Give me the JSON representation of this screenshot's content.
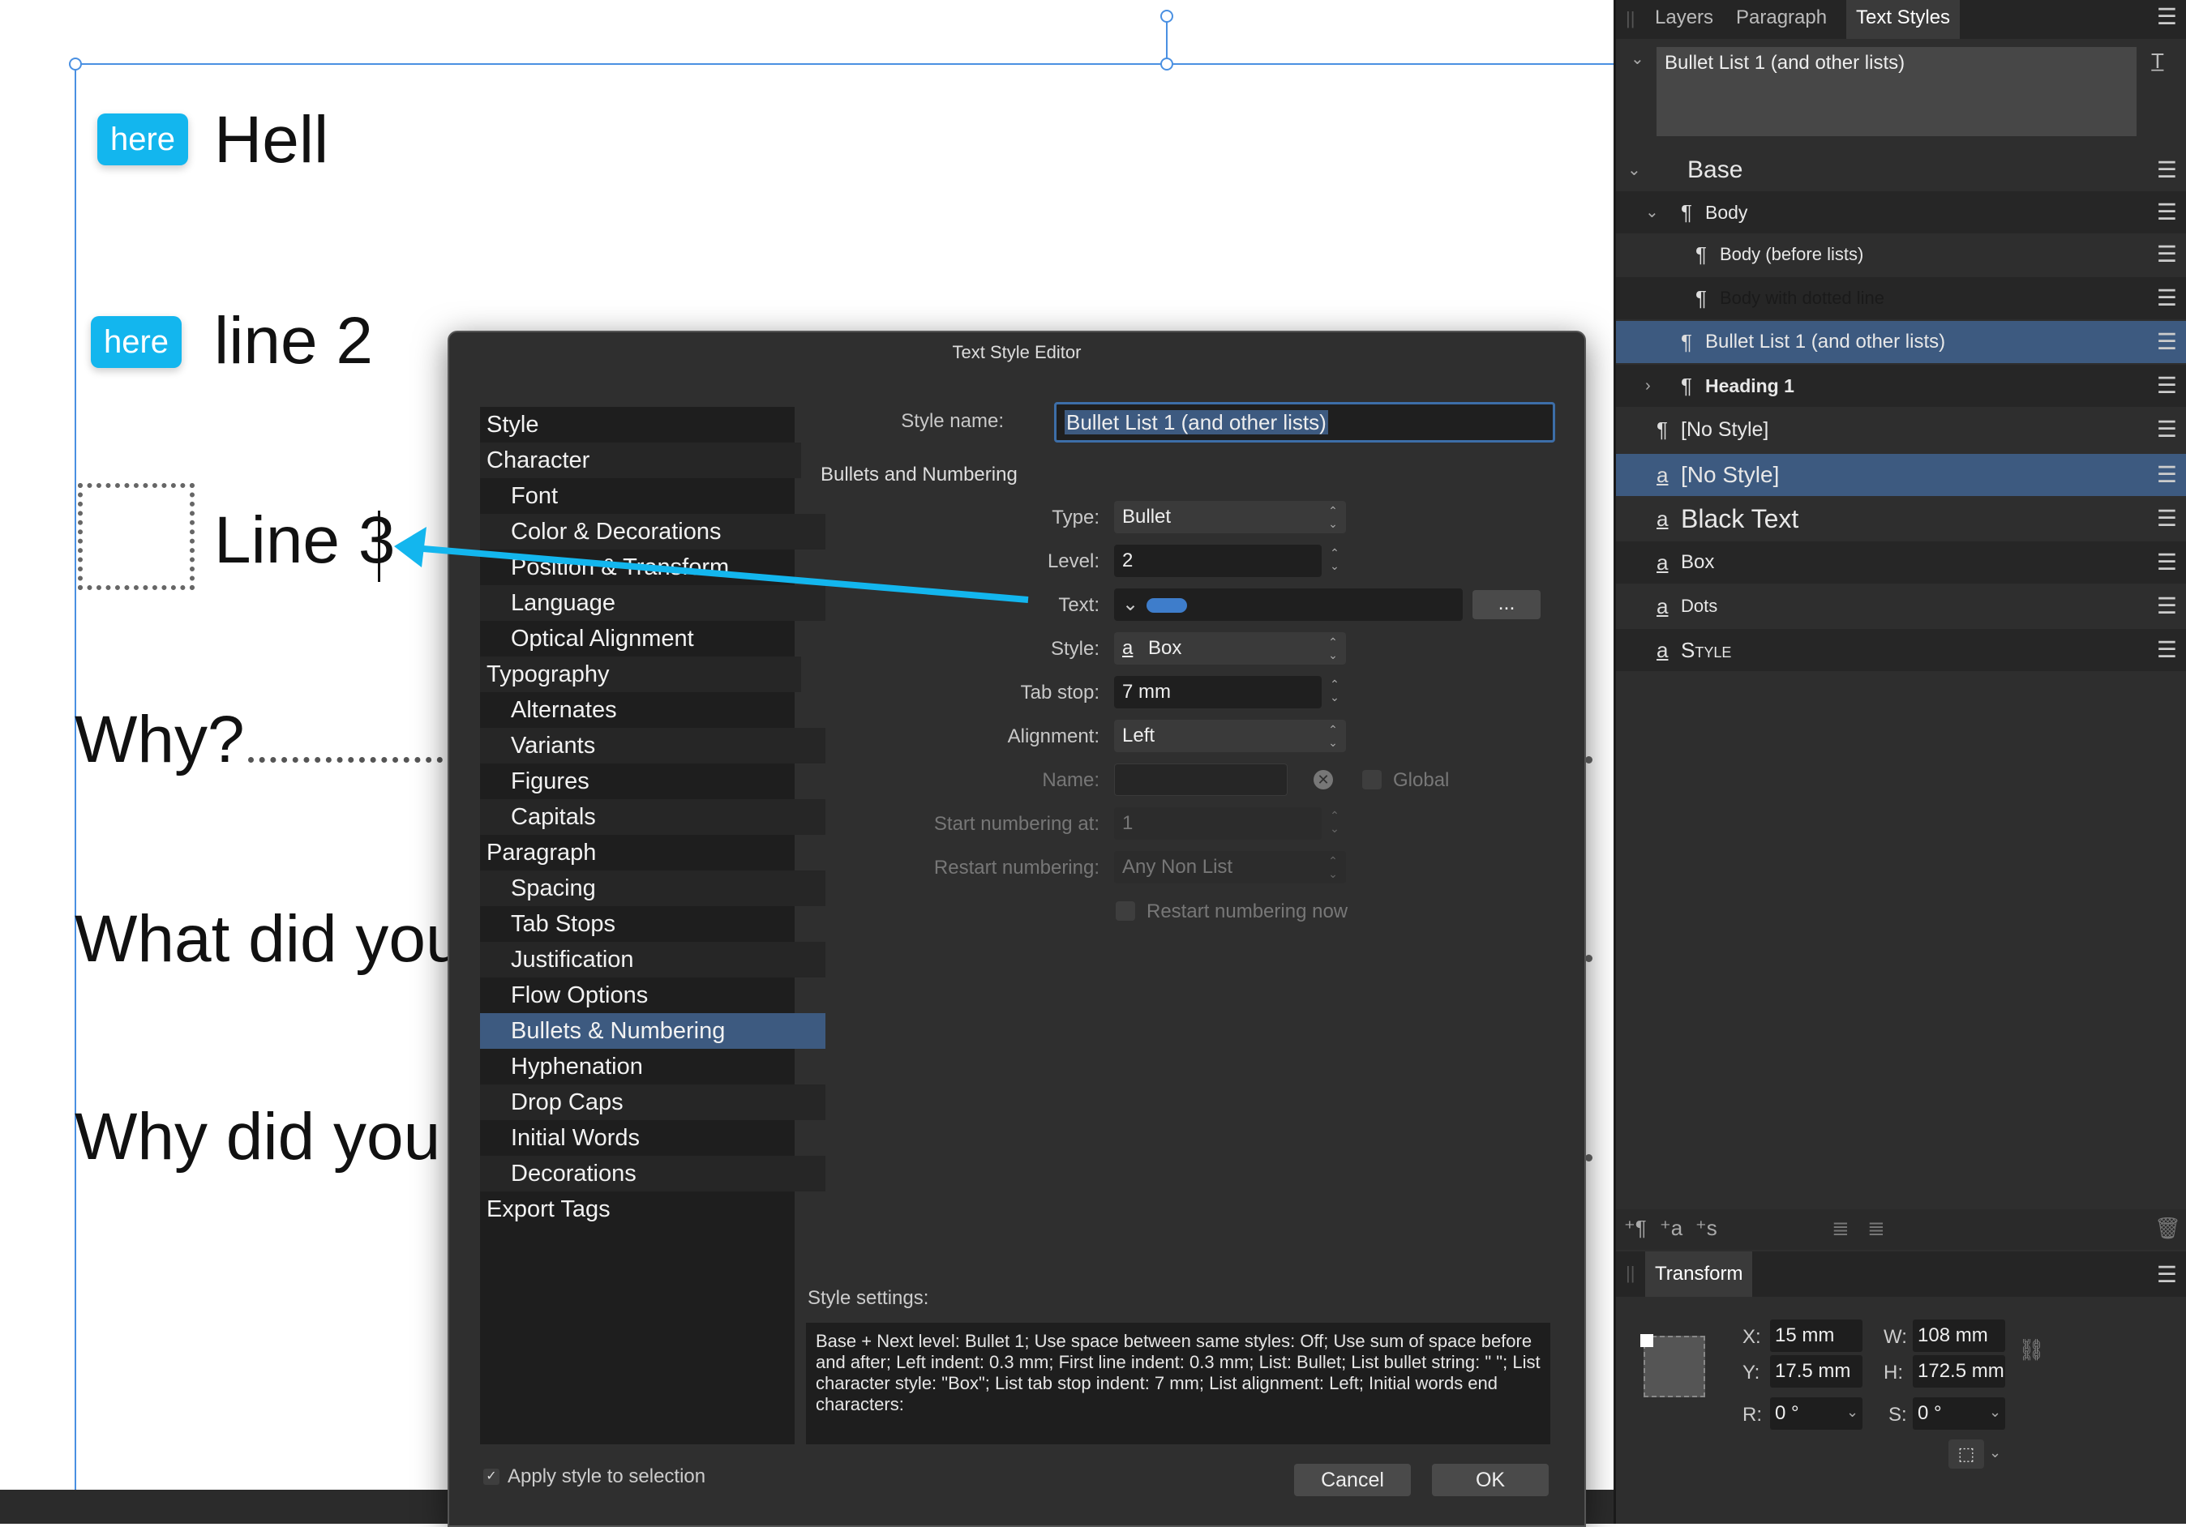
{
  "document": {
    "tags": [
      "here",
      "here"
    ],
    "lines": [
      "Hell",
      "line 2",
      "Line 3",
      "Why?",
      "What did you",
      "Why did you c"
    ]
  },
  "dialog": {
    "title": "Text Style Editor",
    "style_name_label": "Style name:",
    "style_name_value": "Bullet List 1 (and other lists)",
    "categories": [
      {
        "label": "Style",
        "indent": false
      },
      {
        "label": "Character",
        "indent": false
      },
      {
        "label": "Font",
        "indent": true
      },
      {
        "label": "Color & Decorations",
        "indent": true
      },
      {
        "label": "Position & Transform",
        "indent": true
      },
      {
        "label": "Language",
        "indent": true
      },
      {
        "label": "Optical Alignment",
        "indent": true
      },
      {
        "label": "Typography",
        "indent": false
      },
      {
        "label": "Alternates",
        "indent": true
      },
      {
        "label": "Variants",
        "indent": true
      },
      {
        "label": "Figures",
        "indent": true
      },
      {
        "label": "Capitals",
        "indent": true
      },
      {
        "label": "Paragraph",
        "indent": false
      },
      {
        "label": "Spacing",
        "indent": true
      },
      {
        "label": "Tab Stops",
        "indent": true
      },
      {
        "label": "Justification",
        "indent": true
      },
      {
        "label": "Flow Options",
        "indent": true
      },
      {
        "label": "Bullets & Numbering",
        "indent": true,
        "selected": true
      },
      {
        "label": "Hyphenation",
        "indent": true
      },
      {
        "label": "Drop Caps",
        "indent": true
      },
      {
        "label": "Initial Words",
        "indent": true
      },
      {
        "label": "Decorations",
        "indent": true
      },
      {
        "label": "Export Tags",
        "indent": false
      }
    ],
    "section_title": "Bullets and Numbering",
    "type_label": "Type:",
    "type_value": "Bullet",
    "level_label": "Level:",
    "level_value": "2",
    "text_label": "Text:",
    "text_more": "...",
    "style_label": "Style:",
    "style_value": "Box",
    "tabstop_label": "Tab stop:",
    "tabstop_value": "7 mm",
    "alignment_label": "Alignment:",
    "alignment_value": "Left",
    "name_label": "Name:",
    "global_label": "Global",
    "start_label": "Start numbering at:",
    "start_value": "1",
    "restart_label": "Restart numbering:",
    "restart_value": "Any Non List",
    "restart_now_label": "Restart numbering now",
    "settings_label": "Style settings:",
    "settings_text": "Base + Next level: Bullet 1; Use space between same styles: Off; Use sum of space before and after; Left indent: 0.3 mm; First line indent: 0.3 mm; List: Bullet; List bullet string: \"  \"; List character style: \"Box\"; List tab stop indent: 7 mm; List alignment: Left; Initial words end characters:",
    "apply_label": "Apply style to selection",
    "cancel": "Cancel",
    "ok": "OK"
  },
  "panel": {
    "tabs": [
      "Layers",
      "Paragraph",
      "Text Styles"
    ],
    "active_tab": "Text Styles",
    "preview_text": "Bullet List 1 (and other lists)",
    "styles": [
      {
        "label": "Base",
        "kind": "group"
      },
      {
        "label": "Body",
        "kind": "para"
      },
      {
        "label": "Body (before lists)",
        "kind": "para"
      },
      {
        "label": "Body with dotted line",
        "kind": "para"
      },
      {
        "label": "Bullet List 1 (and other lists)",
        "kind": "para"
      },
      {
        "label": "Heading 1",
        "kind": "para"
      },
      {
        "label": "[No Style]",
        "kind": "para"
      },
      {
        "label": "[No Style]",
        "kind": "char"
      },
      {
        "label": "Black Text",
        "kind": "char"
      },
      {
        "label": "Box",
        "kind": "char"
      },
      {
        "label": "Dots",
        "kind": "char"
      },
      {
        "label": "Style",
        "kind": "char"
      }
    ],
    "transform_tab": "Transform",
    "transform": {
      "x_label": "X:",
      "x": "15 mm",
      "y_label": "Y:",
      "y": "17.5 mm",
      "w_label": "W:",
      "w": "108 mm",
      "h_label": "H:",
      "h": "172.5 mm",
      "r_label": "R:",
      "r": "0 °",
      "s_label": "S:",
      "s": "0 °"
    }
  },
  "colors": {
    "accent": "#13b6ee",
    "selection": "#3d5a80",
    "guide": "#4a90e2"
  }
}
